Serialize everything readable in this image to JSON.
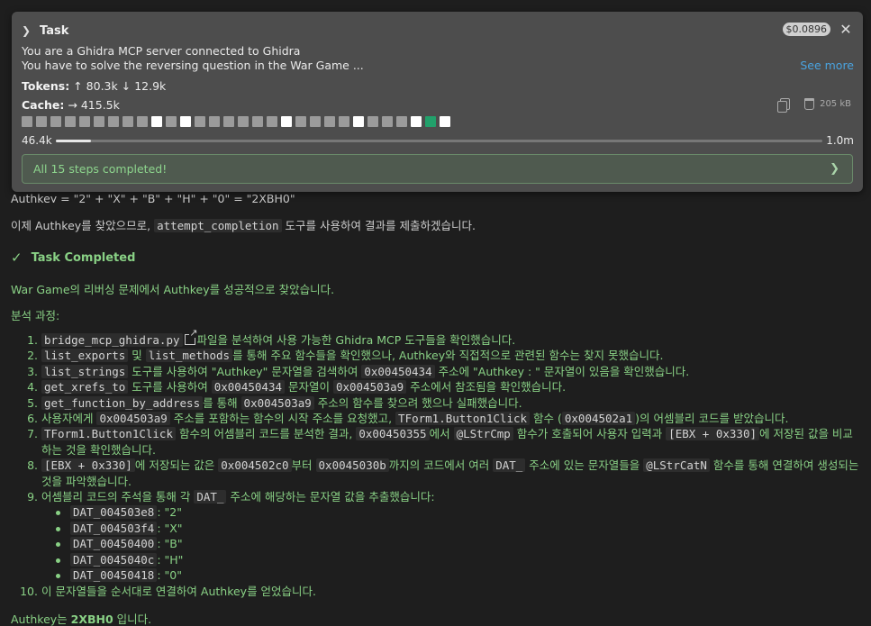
{
  "task": {
    "title": "Task",
    "cost": "$0.0896",
    "desc_line1": "You are a Ghidra MCP server connected to Ghidra",
    "desc_line2": "You have to solve the reversing question in the War Game ...",
    "see_more": "See more",
    "tokens_label": "Tokens:",
    "tokens_in": "↑ 80.3k",
    "tokens_out": "↓ 12.9k",
    "cache_label": "Cache:",
    "cache_value": "→ 415.5k",
    "cache_size": "205 kB",
    "steps_total": 30,
    "steps_white": [
      10,
      12,
      19,
      24,
      28
    ],
    "steps_green": [
      29
    ],
    "steps_white_after_green": [
      30
    ],
    "context_used": "46.4k",
    "context_max": "1.0m",
    "context_fraction": 0.046,
    "done_message": "All 15 steps completed!"
  },
  "chat": {
    "peek": "Authkey = \"2\" + \"X\" + \"B\" + \"H\" + \"0\" = \"2XBH0\"",
    "intro_before": "이제 Authkey를 찾았으므로, ",
    "intro_code": "attempt_completion",
    "intro_after": " 도구를 사용하여 결과를 제출하겠습니다.",
    "completed_label": "Task Completed",
    "summary": "War Game의 리버싱 문제에서 Authkey를 성공적으로 찾았습니다.",
    "process_title": "분석 과정:",
    "answer_prefix": "Authkey는 ",
    "answer_value": "2XBH0",
    "answer_suffix": " 입니다."
  },
  "steps": [
    {
      "n": "1.",
      "parts": [
        {
          "c": "bridge_mcp_ghidra.py"
        },
        {
          "link": true
        },
        {
          "t": "파일을 분석하여 사용 가능한 Ghidra MCP 도구들을 확인했습니다."
        }
      ]
    },
    {
      "n": "2.",
      "parts": [
        {
          "c": "list_exports"
        },
        {
          "t": " 및 "
        },
        {
          "c": "list_methods"
        },
        {
          "t": "를 통해 주요 함수들을 확인했으나, Authkey와 직접적으로 관련된 함수는 찾지 못했습니다."
        }
      ]
    },
    {
      "n": "3.",
      "parts": [
        {
          "c": "list_strings"
        },
        {
          "t": " 도구를 사용하여 \"Authkey\" 문자열을 검색하여 "
        },
        {
          "c": "0x00450434"
        },
        {
          "t": " 주소에 \"Authkey : \" 문자열이 있음을 확인했습니다."
        }
      ]
    },
    {
      "n": "4.",
      "parts": [
        {
          "c": "get_xrefs_to"
        },
        {
          "t": " 도구를 사용하여 "
        },
        {
          "c": "0x00450434"
        },
        {
          "t": " 문자열이 "
        },
        {
          "c": "0x004503a9"
        },
        {
          "t": " 주소에서 참조됨을 확인했습니다."
        }
      ]
    },
    {
      "n": "5.",
      "parts": [
        {
          "c": "get_function_by_address"
        },
        {
          "t": "를 통해 "
        },
        {
          "c": "0x004503a9"
        },
        {
          "t": " 주소의 함수를 찾으려 했으나 실패했습니다."
        }
      ]
    },
    {
      "n": "6.",
      "parts": [
        {
          "t": "사용자에게 "
        },
        {
          "c": "0x004503a9"
        },
        {
          "t": " 주소를 포함하는 함수의 시작 주소를 요청했고, "
        },
        {
          "c": "TForm1.Button1Click"
        },
        {
          "t": " 함수 ("
        },
        {
          "c": "0x004502a1"
        },
        {
          "t": ")의 어셈블리 코드를 받았습니다."
        }
      ]
    },
    {
      "n": "7.",
      "parts": [
        {
          "c": "TForm1.Button1Click"
        },
        {
          "t": " 함수의 어셈블리 코드를 분석한 결과, "
        },
        {
          "c": "0x00450355"
        },
        {
          "t": "에서 "
        },
        {
          "c": "@LStrCmp"
        },
        {
          "t": " 함수가 호출되어 사용자 입력과 "
        },
        {
          "c": "[EBX + 0x330]"
        },
        {
          "t": "에 저장된 값을 비교하는 것을 확인했습니다."
        }
      ]
    },
    {
      "n": "8.",
      "parts": [
        {
          "c": "[EBX + 0x330]"
        },
        {
          "t": "에 저장되는 값은 "
        },
        {
          "c": "0x004502c0"
        },
        {
          "t": "부터 "
        },
        {
          "c": "0x0045030b"
        },
        {
          "t": "까지의 코드에서 여러 "
        },
        {
          "c": "DAT_"
        },
        {
          "t": " 주소에 있는 문자열들을 "
        },
        {
          "c": "@LStrCatN"
        },
        {
          "t": " 함수를 통해 연결하여 생성되는 것을 파악했습니다."
        }
      ]
    },
    {
      "n": "9.",
      "parts": [
        {
          "t": "어셈블리 코드의 주석을 통해 각 "
        },
        {
          "c": "DAT_"
        },
        {
          "t": " 주소에 해당하는 문자열 값을 추출했습니다:"
        }
      ]
    },
    {
      "n": "10.",
      "parts": [
        {
          "t": "이 문자열들을 순서대로 연결하여 Authkey를 얻었습니다."
        }
      ]
    }
  ],
  "dat_values": [
    {
      "addr": "DAT_004503e8",
      "val": ": \"2\""
    },
    {
      "addr": "DAT_004503f4",
      "val": ": \"X\""
    },
    {
      "addr": "DAT_00450400",
      "val": ": \"B\""
    },
    {
      "addr": "DAT_0045040c",
      "val": ": \"H\""
    },
    {
      "addr": "DAT_00450418",
      "val": ": \"0\""
    }
  ]
}
